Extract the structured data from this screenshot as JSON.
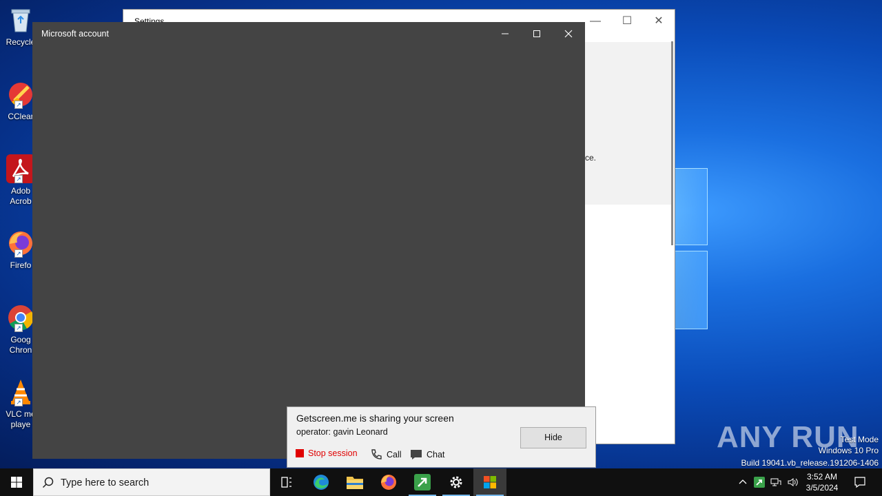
{
  "desktop": {
    "icons": [
      {
        "name": "recycle-bin-icon",
        "label": "Recycle"
      },
      {
        "name": "ccleaner-icon",
        "label": "CClear"
      },
      {
        "name": "adobe-acrobat-icon",
        "label": "Adob Acrob"
      },
      {
        "name": "firefox-icon",
        "label": "Firefo"
      },
      {
        "name": "google-chrome-icon",
        "label": "Goog Chron"
      },
      {
        "name": "vlc-icon",
        "label": "VLC me playe"
      }
    ]
  },
  "settings_window": {
    "title": "Settings",
    "snippet": "ce."
  },
  "ms_account_window": {
    "title": "Microsoft account"
  },
  "getscreen_popup": {
    "title": "Getscreen.me is sharing your screen",
    "operator": "operator: gavin Leonard",
    "hide_label": "Hide",
    "stop_label": "Stop session",
    "call_label": "Call",
    "chat_label": "Chat",
    "stop_color": "#e00000"
  },
  "watermark": {
    "brand": "ANY RUN",
    "mode": "Test Mode",
    "edition": "Windows 10 Pro",
    "build": "Build 19041.vb_release.191206-1406"
  },
  "taskbar": {
    "search_placeholder": "Type here to search",
    "apps": [
      "task-view",
      "edge",
      "file-explorer",
      "firefox",
      "getscreen",
      "settings",
      "store"
    ],
    "time": "3:52 AM",
    "date": "3/5/2024"
  },
  "colors": {
    "dialog_bg": "#444444",
    "taskbar_bg": "#101010",
    "accent": "#76b9ed"
  }
}
